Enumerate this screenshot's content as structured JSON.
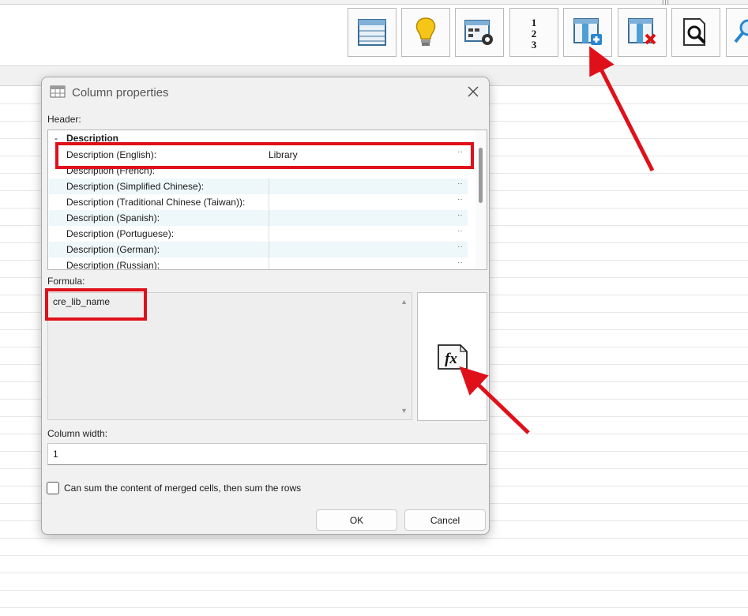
{
  "toolbar": {
    "buttons": [
      {
        "icon": "table-view-icon"
      },
      {
        "icon": "lightbulb-icon"
      },
      {
        "icon": "table-settings-icon"
      },
      {
        "icon": "numbering-icon",
        "glyph": "1\n2\n3"
      },
      {
        "icon": "insert-column-icon"
      },
      {
        "icon": "delete-column-icon"
      },
      {
        "icon": "preview-search-icon"
      },
      {
        "icon": "magnify-icon"
      }
    ]
  },
  "dialog": {
    "title": "Column properties",
    "header_label": "Header:",
    "group": {
      "collapse_glyph": "-",
      "name": "Description"
    },
    "rows": [
      {
        "name": "Description (English):",
        "value": "Library",
        "dots": "··"
      },
      {
        "name": "Description (French):",
        "value": "",
        "dots": ""
      },
      {
        "name": "Description (Simplified Chinese):",
        "value": "",
        "dots": "··"
      },
      {
        "name": "Description (Traditional Chinese (Taiwan)):",
        "value": "",
        "dots": "··"
      },
      {
        "name": "Description (Spanish):",
        "value": "",
        "dots": "··"
      },
      {
        "name": "Description (Portuguese):",
        "value": "",
        "dots": "··"
      },
      {
        "name": "Description (German):",
        "value": "",
        "dots": "··"
      },
      {
        "name": "Description (Russian):",
        "value": "",
        "dots": "··"
      }
    ],
    "formula_label": "Formula:",
    "formula_value": "cre_lib_name",
    "fx_glyph": "fx",
    "column_width_label": "Column width:",
    "column_width_value": "1",
    "merge_checkbox_label": "Can sum the content of merged cells, then sum the rows",
    "merge_checked": false,
    "ok_label": "OK",
    "cancel_label": "Cancel"
  },
  "colors": {
    "annotation_red": "#e0101a",
    "alt_row": "#eef7f9"
  }
}
